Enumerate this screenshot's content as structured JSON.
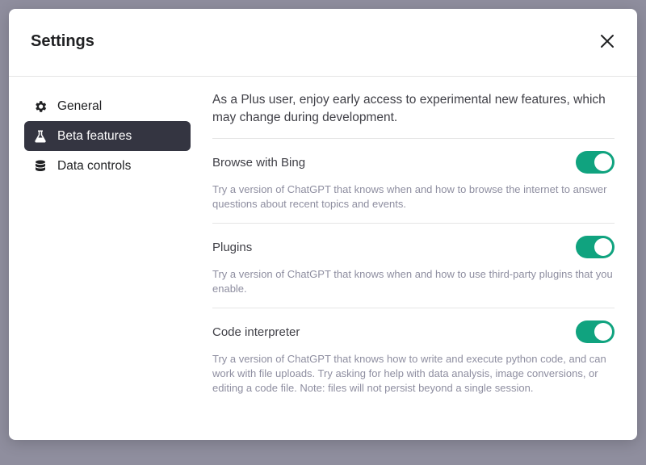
{
  "dialog": {
    "title": "Settings",
    "close_icon": "close-icon"
  },
  "sidebar": {
    "items": [
      {
        "label": "General",
        "icon": "gear-icon",
        "active": false
      },
      {
        "label": "Beta features",
        "icon": "flask-icon",
        "active": true
      },
      {
        "label": "Data controls",
        "icon": "database-icon",
        "active": false
      }
    ]
  },
  "content": {
    "intro": "As a Plus user, enjoy early access to experimental new features, which may change during development.",
    "features": [
      {
        "title": "Browse with Bing",
        "description": "Try a version of ChatGPT that knows when and how to browse the internet to answer questions about recent topics and events.",
        "enabled": true
      },
      {
        "title": "Plugins",
        "description": "Try a version of ChatGPT that knows when and how to use third-party plugins that you enable.",
        "enabled": true
      },
      {
        "title": "Code interpreter",
        "description": "Try a version of ChatGPT that knows how to write and execute python code, and can work with file uploads. Try asking for help with data analysis, image conversions, or editing a code file. Note: files will not persist beyond a single session.",
        "enabled": true
      }
    ]
  },
  "colors": {
    "toggle_on": "#10a37f",
    "active_nav_bg": "#343541",
    "backdrop": "#8f8e9e"
  }
}
